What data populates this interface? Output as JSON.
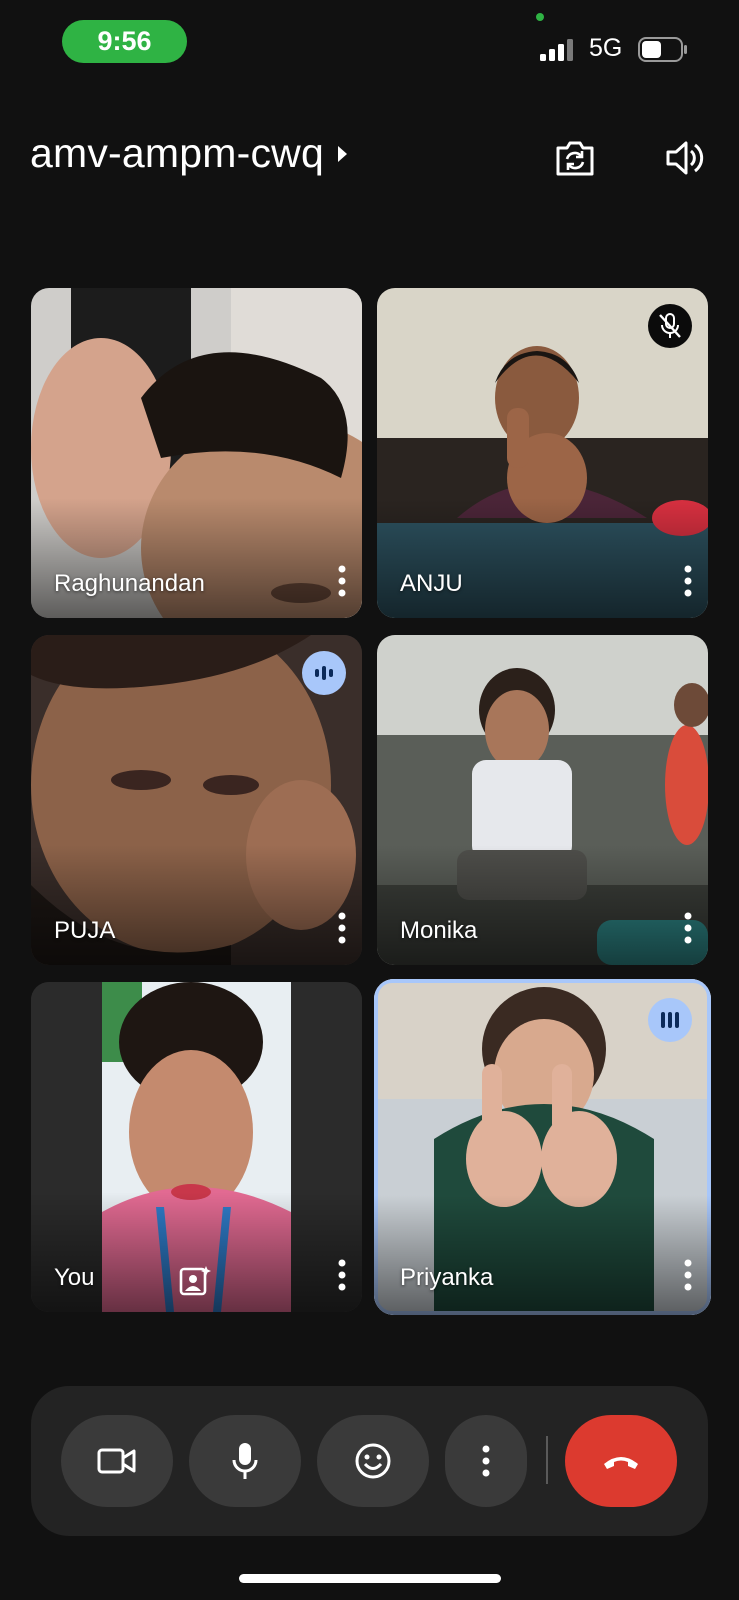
{
  "status_bar": {
    "time": "9:56",
    "network": "5G",
    "signal_icon": "signal-bars-icon",
    "battery_icon": "battery-icon"
  },
  "header": {
    "meeting_code": "amv-ampm-cwq",
    "meeting_info_icon": "chevron-right-icon",
    "switch_camera_icon": "switch-camera-icon",
    "speaker_icon": "speaker-icon"
  },
  "participants": [
    {
      "name": "Raghunandan",
      "status": "camera-on"
    },
    {
      "name": "ANJU",
      "status": "muted"
    },
    {
      "name": "PUJA",
      "status": "speaking"
    },
    {
      "name": "Monika",
      "status": "camera-on"
    },
    {
      "name": "You",
      "status": "self-view"
    },
    {
      "name": "Priyanka",
      "status": "active-speaker"
    }
  ],
  "controls": {
    "camera_icon": "video-camera-icon",
    "mic_icon": "microphone-icon",
    "reactions_icon": "emoji-icon",
    "more_icon": "more-vertical-icon",
    "end_call_icon": "end-call-icon"
  },
  "colors": {
    "background": "#111111",
    "time_pill": "#2fb344",
    "speaking_badge": "#a8c7fa",
    "end_call": "#dc3a2f",
    "control_bar": "#232323",
    "control_button": "#3a3a3a"
  }
}
